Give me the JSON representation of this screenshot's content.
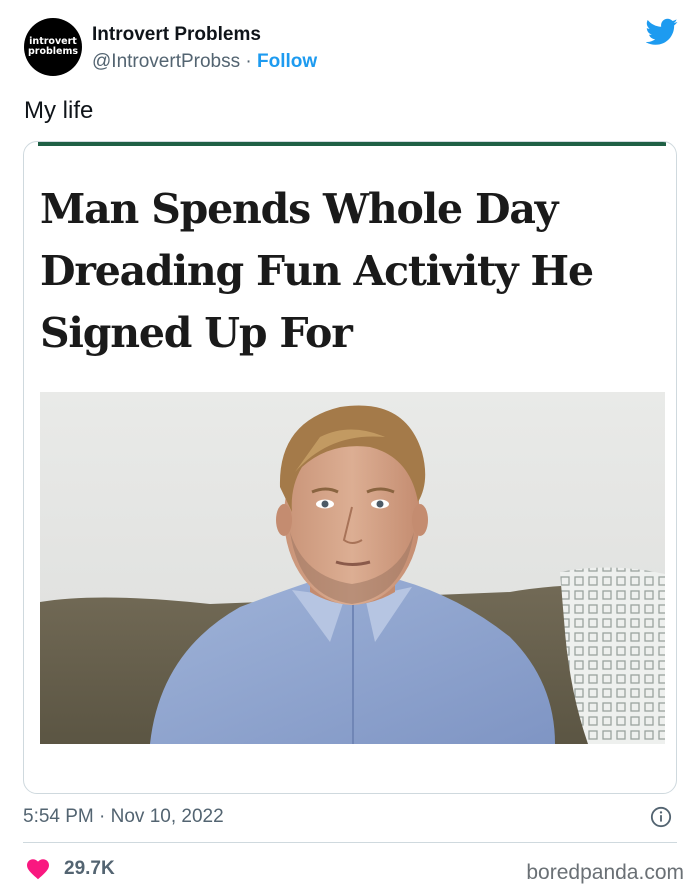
{
  "author": {
    "avatar_line1": "introvert",
    "avatar_line2": "problems",
    "name": "Introvert Problems",
    "handle": "@IntrovertProbss",
    "separator": " · ",
    "follow_label": "Follow"
  },
  "tweet": {
    "text": "My life",
    "timestamp": "5:54 PM · Nov 10, 2022",
    "likes": "29.7K"
  },
  "card": {
    "headline": "Man Spends Whole Day Dreading Fun Activity He Signed Up For",
    "accent_color": "#1f6045"
  },
  "icons": {
    "brand": "twitter-bird-icon",
    "info": "info-icon",
    "like": "heart-icon"
  },
  "colors": {
    "twitter_blue": "#1d9bf0",
    "like_red": "#f91880",
    "muted_text": "#536471"
  },
  "watermark": "boredpanda.com"
}
